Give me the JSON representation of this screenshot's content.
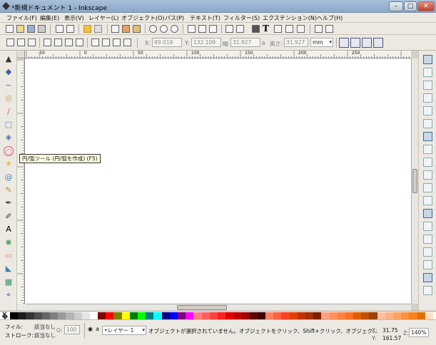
{
  "window": {
    "title": "*新規ドキュメント 1 - Inkscape",
    "buttons": [
      "–",
      "□",
      "✕"
    ]
  },
  "menu": [
    "ファイル(F)",
    "編集(E)",
    "表示(V)",
    "レイヤー(L)",
    "オブジェクト(O)",
    "パス(P)",
    "テキスト(T)",
    "フィルター(S)",
    "エクステンション(N)",
    "ヘルプ(H)"
  ],
  "controls": {
    "x_label": "X:",
    "x_value": "89.019",
    "y_label": "Y:",
    "y_value": "132.109",
    "w_label": "幅:",
    "w_value": "31.927",
    "lock_label": "a",
    "h_label": "高さ:",
    "h_value": "31.927",
    "unit": "mm"
  },
  "ruler": {
    "h_ticks": [
      "-50",
      "0",
      "50",
      "100",
      "150",
      "200",
      "250"
    ]
  },
  "tooltip": "円/弧ツール (円/弧を作成) (F5)",
  "status": {
    "fill_label": "フィル:",
    "fill_value": "該当なし",
    "stroke_label": "ストローク:",
    "stroke_value": "該当なし",
    "opacity_label": "O:",
    "opacity_value": "100",
    "layer": "•レイヤー 1",
    "message": "オブジェクトが選択されていません。オブジェクトをクリック、Shift+クリック、オブジェク…",
    "cursor_x_label": "X:",
    "cursor_x": "31.75",
    "cursor_y_label": "Y:",
    "cursor_y": "161.57",
    "zoom_label": "Z:",
    "zoom": "140%"
  },
  "colors": {
    "canvas": "#ffffff",
    "chrome": "#ece9e2",
    "tooltip": "#ffffe1",
    "accent": "#3a78c8"
  },
  "tools": [
    "selector-icon",
    "node-icon",
    "tweak-icon",
    "zoom-icon",
    "measure-icon",
    "rect-icon",
    "3dbox-icon",
    "ellipse-icon",
    "star-icon",
    "spiral-icon",
    "pencil-icon",
    "pen-icon",
    "calligraphy-icon",
    "text-icon",
    "spray-icon",
    "eraser-icon",
    "bucket-icon",
    "gradient-icon",
    "dropper-icon"
  ],
  "snap_icons": [
    "snap-toggle-icon",
    "snap-bbox-icon",
    "snap-bbox-edge-icon",
    "snap-bbox-corner-icon",
    "snap-bbox-mid-icon",
    "snap-bbox-center-icon",
    "snap-nodes-icon",
    "snap-path-icon",
    "snap-intersection-icon",
    "snap-cusp-icon",
    "snap-smooth-icon",
    "snap-midpoint-icon",
    "snap-others-icon",
    "snap-object-center-icon",
    "snap-rotation-icon",
    "snap-text-icon",
    "snap-page-icon",
    "snap-grid-icon",
    "snap-guide-icon"
  ]
}
